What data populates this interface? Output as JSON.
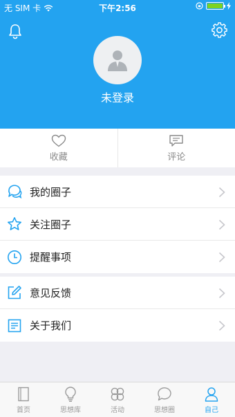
{
  "status": {
    "carrier": "无 SIM 卡",
    "time": "下午2:56",
    "battery_level": 1.0
  },
  "header": {
    "login_label": "未登录"
  },
  "actions": [
    {
      "label": "收藏",
      "icon": "heart-icon"
    },
    {
      "label": "评论",
      "icon": "comment-icon"
    }
  ],
  "menu": {
    "group1": [
      {
        "label": "我的圈子",
        "icon": "chat-bubbles-icon"
      },
      {
        "label": "关注圈子",
        "icon": "star-icon"
      },
      {
        "label": "提醒事项",
        "icon": "clock-icon"
      }
    ],
    "group2": [
      {
        "label": "意见反馈",
        "icon": "edit-icon"
      },
      {
        "label": "关于我们",
        "icon": "document-icon"
      }
    ]
  },
  "tabs": [
    {
      "label": "首页",
      "icon": "home-book-icon"
    },
    {
      "label": "思想库",
      "icon": "lightbulb-icon"
    },
    {
      "label": "活动",
      "icon": "circles-icon"
    },
    {
      "label": "思想圈",
      "icon": "chat-icon"
    },
    {
      "label": "自己",
      "icon": "person-icon",
      "active": true
    }
  ],
  "colors": {
    "accent": "#23a3f0",
    "background": "#efeff4",
    "battery": "#7ed321"
  }
}
